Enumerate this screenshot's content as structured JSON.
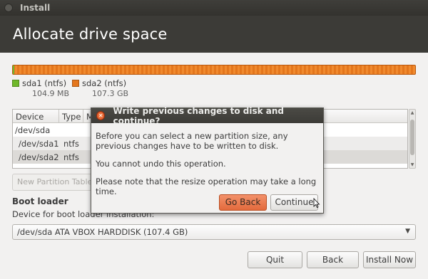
{
  "window": {
    "title": "Install"
  },
  "page": {
    "heading": "Allocate drive space"
  },
  "colors": {
    "accent": "#dd4814",
    "partition_fill": "#f08a2e",
    "sda1": "#6fb82a",
    "sda2": "#e4761c"
  },
  "partitions_legend": [
    {
      "name": "sda1 (ntfs)",
      "size": "104.9 MB",
      "color": "#6fb82a"
    },
    {
      "name": "sda2 (ntfs)",
      "size": "107.3 GB",
      "color": "#e4761c"
    }
  ],
  "table": {
    "columns": [
      "Device",
      "Type",
      "M"
    ],
    "rows": [
      {
        "device": "/dev/sda",
        "type": ""
      },
      {
        "device": "/dev/sda1",
        "type": "ntfs"
      },
      {
        "device": "/dev/sda2",
        "type": "ntfs"
      }
    ]
  },
  "new_partition_table_label": "New Partition Table...",
  "boot_loader": {
    "heading": "Boot loader",
    "label": "Device for boot loader installation:",
    "selected": "/dev/sda ATA VBOX HARDDISK (107.4 GB)"
  },
  "footer": {
    "quit": "Quit",
    "back": "Back",
    "install_now": "Install Now"
  },
  "dialog": {
    "title": "Write previous changes to disk and continue?",
    "paragraphs": [
      "Before you can select a new partition size, any previous changes have to be written to disk.",
      "You cannot undo this operation.",
      "Please note that the resize operation may take a long time."
    ],
    "go_back": "Go Back",
    "continue": "Continue"
  }
}
